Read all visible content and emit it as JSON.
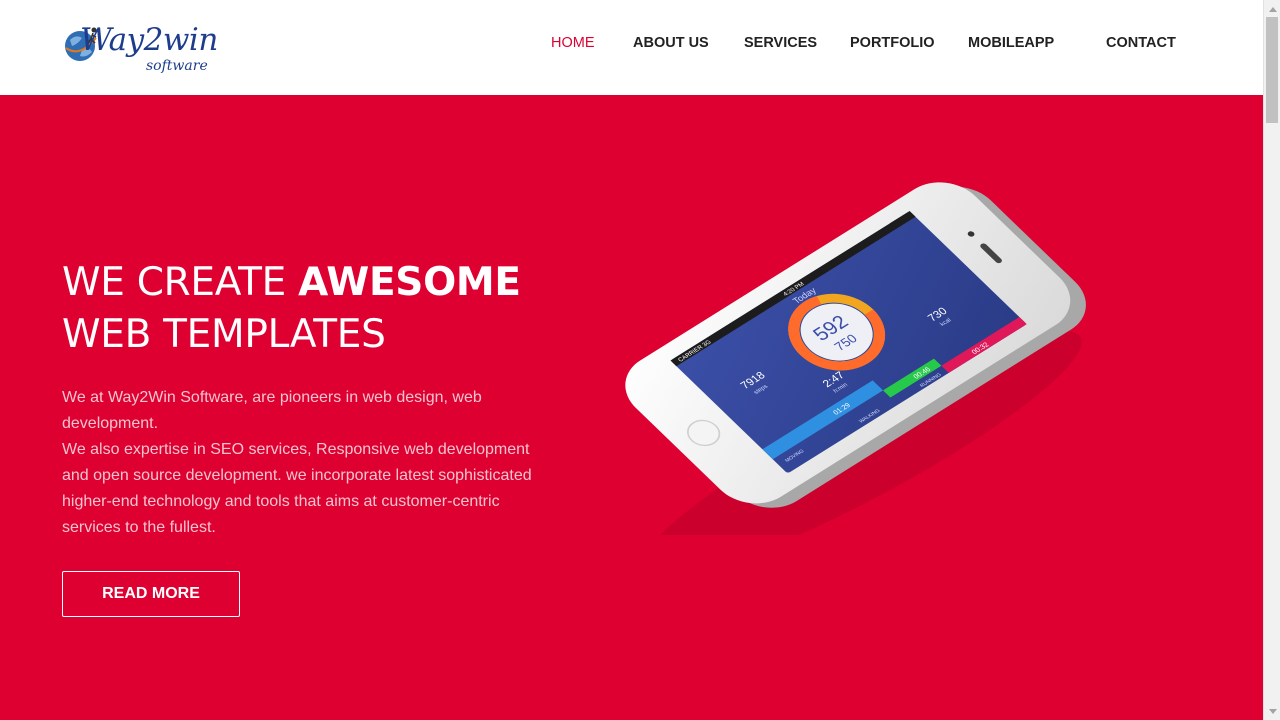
{
  "brand": {
    "name_main": "Way2win",
    "name_sub": "software",
    "accent_color": "#dd0031",
    "logo_color": "#1d3d8c"
  },
  "nav": {
    "items": [
      {
        "label": "HOME",
        "active": true
      },
      {
        "label": "ABOUT US",
        "active": false
      },
      {
        "label": "SERVICES",
        "active": false
      },
      {
        "label": "PORTFOLIO",
        "active": false
      },
      {
        "label": "MOBILEAPP",
        "active": false
      },
      {
        "label": "CONTACT",
        "active": false
      }
    ]
  },
  "hero": {
    "title_line1_prefix": "WE CREATE ",
    "title_line1_bold": "AWESOME",
    "title_line2": "WEB TEMPLATES",
    "paragraph1": "We at Way2Win Software, are pioneers in web design, web development.",
    "paragraph2": "We also expertise in SEO services, Responsive web development and open source development. we incorporate latest sophisticated higher-end technology and tools that aims at customer-centric services to the fullest.",
    "button_label": "READ MORE"
  },
  "phone_screen": {
    "status": "CARRIER 3G",
    "time": "4:20 PM",
    "header": "Today",
    "ring_value": "592",
    "ring_target": "750",
    "stat_steps_value": "7918",
    "stat_steps_label": "steps",
    "stat_time_value": "2:47",
    "stat_time_label": "h:min",
    "stat_kcal_value": "730",
    "stat_kcal_label": "kcal",
    "bar_moving_label": "MOVING",
    "bar_moving_time": "01:29",
    "bar_walking_label": "WALKING",
    "bar_walking_time": "00:46",
    "bar_running_label": "RUNNING",
    "bar_running_time": "00:32"
  }
}
